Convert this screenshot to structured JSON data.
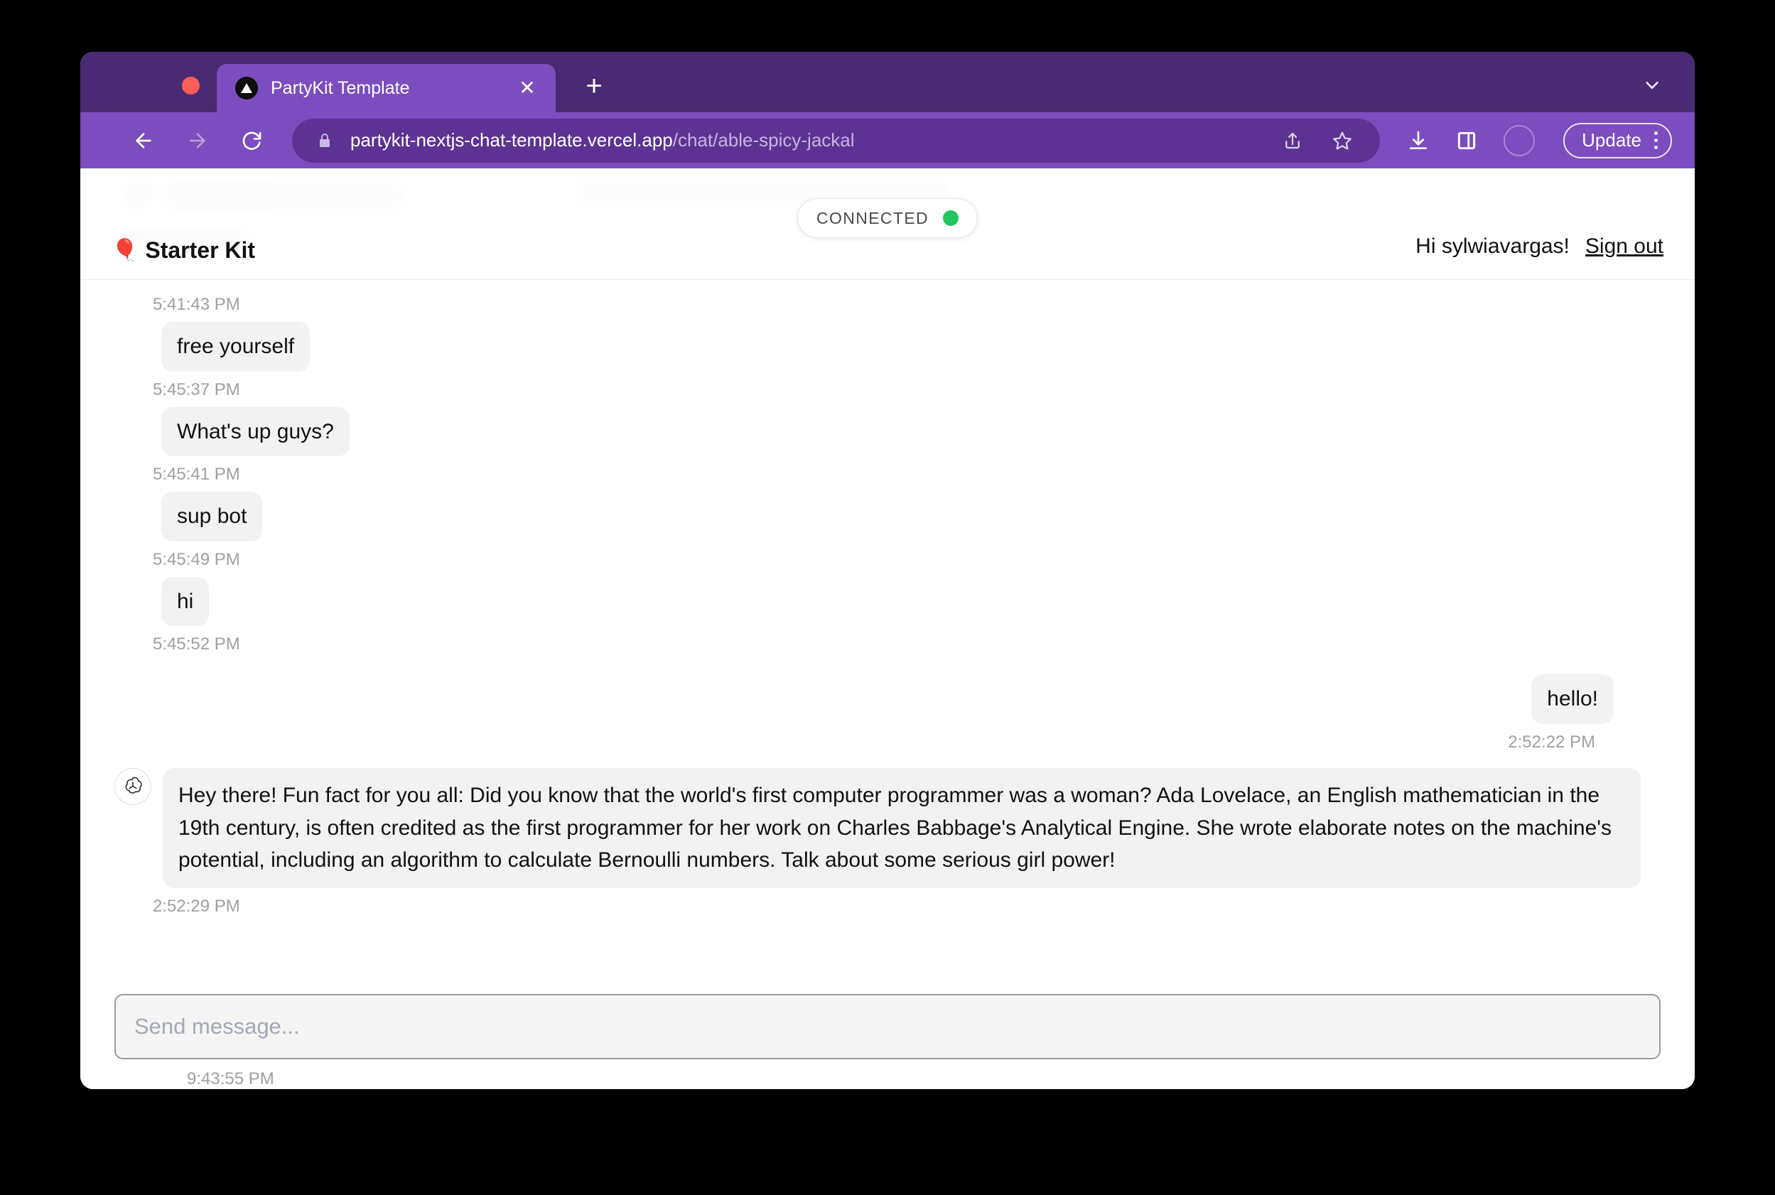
{
  "browser": {
    "tab": {
      "title": "PartyKit Template",
      "favicon": "triangle-logo-icon",
      "close_label": "✕"
    },
    "new_tab_label": "+",
    "toolbar": {
      "back_icon": "back-arrow-icon",
      "forward_icon": "forward-arrow-icon",
      "reload_icon": "reload-icon",
      "lock_icon": "lock-icon",
      "url_domain": "partykit-nextjs-chat-template.vercel.app",
      "url_path": "/chat/able-spicy-jackal",
      "share_icon": "share-icon",
      "bookmark_icon": "star-icon",
      "download_icon": "download-icon",
      "sidepanel_icon": "side-panel-icon",
      "profile_icon": "profile-avatar",
      "update_label": "Update",
      "menu_icon": "kebab-menu-icon"
    },
    "colors": {
      "tabstrip_bg": "#4a2a73",
      "toolbar_bg": "#7c4dbe",
      "active_tab_bg": "#7c4dbe",
      "omnibox_bg": "#5c3392"
    }
  },
  "app": {
    "room_title": "Starter Kit",
    "room_emoji": "🎈",
    "status": {
      "label": "CONNECTED",
      "dot_color": "#22c55e"
    },
    "user": {
      "greeting": "Hi sylwiavargas!",
      "signout_label": "Sign out"
    },
    "composer": {
      "placeholder": "Send message...",
      "value": ""
    },
    "trailing_timestamp": "9:43:55 PM",
    "messages": [
      {
        "timestamp": "5:41:43 PM",
        "position": "above",
        "text": "free yourself",
        "side": "left",
        "avatar": "av-blue"
      },
      {
        "timestamp": "5:45:37 PM",
        "position": "above",
        "text": "What's up guys?",
        "side": "left",
        "avatar": "av-pink"
      },
      {
        "timestamp": "5:45:41 PM",
        "position": "above",
        "text": "sup bot",
        "side": "left",
        "avatar": "av-blue"
      },
      {
        "timestamp": "5:45:49 PM",
        "position": "above",
        "text": "hi",
        "side": "left",
        "avatar": "av-yellow"
      },
      {
        "timestamp": "5:45:52 PM",
        "position": "above",
        "text": "hello!",
        "side": "right",
        "avatar": "av-sylwia"
      },
      {
        "timestamp": "2:52:22 PM",
        "position": "below",
        "text": "",
        "side": "right-ts",
        "avatar": ""
      },
      {
        "timestamp": "2:52:29 PM",
        "position": "below",
        "text": "Hey there! Fun fact for you all: Did you know that the world's first computer programmer was a woman? Ada Lovelace, an English mathematician in the 19th century, is often credited as the first programmer for her work on Charles Babbage's Analytical Engine. She wrote elaborate notes on the machine's potential, including an algorithm to calculate Bernoulli numbers. Talk about some serious girl power!",
        "side": "left",
        "avatar": "openai"
      }
    ],
    "timeline": {
      "ts0": "5:41:43 PM",
      "msg1": "free yourself",
      "ts1": "5:45:37 PM",
      "msg2": "What's up guys?",
      "ts2": "5:45:41 PM",
      "msg3": "sup bot",
      "ts3": "5:45:49 PM",
      "msg4": "hi",
      "ts4": "5:45:52 PM",
      "msg5": "hello!",
      "ts5": "2:52:22 PM",
      "msg6": "Hey there! Fun fact for you all: Did you know that the world's first computer programmer was a woman? Ada Lovelace, an English mathematician in the 19th century, is often credited as the first programmer for her work on Charles Babbage's Analytical Engine. She wrote elaborate notes on the machine's potential, including an algorithm to calculate Bernoulli numbers. Talk about some serious girl power!",
      "ts6": "2:52:29 PM"
    }
  }
}
